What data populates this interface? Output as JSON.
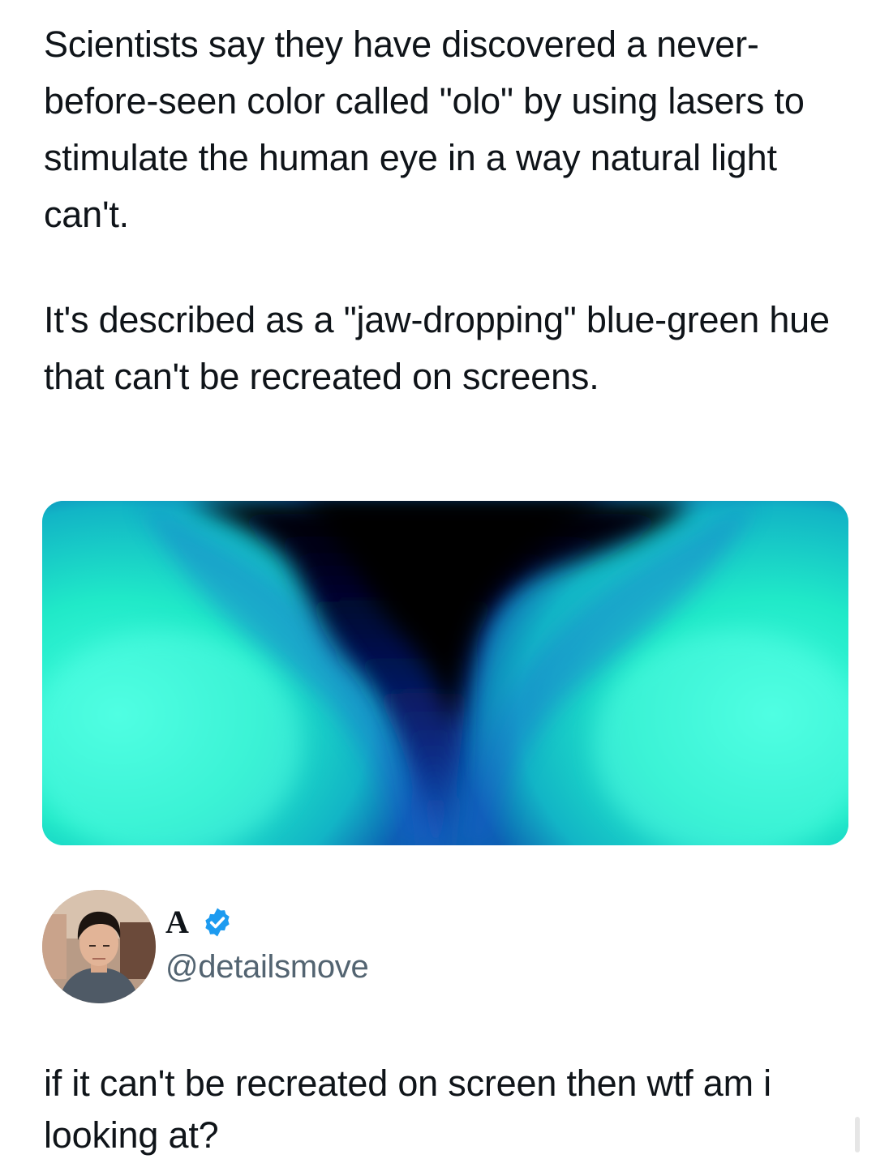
{
  "post": {
    "paragraph_1": "Scientists say they have discovered a never-before-seen color called \"olo\" by using lasers to stimulate the human eye in a way natural light can't.",
    "paragraph_2": "It's described as a \"jaw-dropping\" blue-green hue that can't be recreated on screens."
  },
  "media": {
    "colors": {
      "teal_bright": "#40ffd9",
      "teal_mid": "#1ae8c8",
      "blue_mid": "#1a6fd0",
      "deep_blue": "#06105a",
      "black": "#000000"
    }
  },
  "reply": {
    "display_name": "A",
    "verified": true,
    "verified_color": "#1d9bf0",
    "handle": "@detailsmove",
    "text": "if it can't be recreated on screen then wtf am i looking at?"
  }
}
